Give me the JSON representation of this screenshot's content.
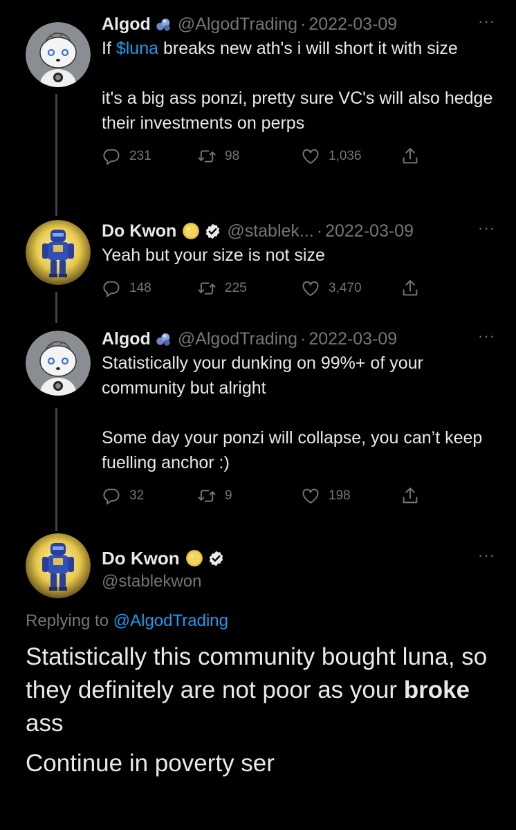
{
  "tweets": [
    {
      "name": "Algod",
      "handle": "@AlgodTrading",
      "date": "2022-03-09",
      "text_before": "If ",
      "cashtag": "$luna",
      "text_after": " breaks new ath's i will short it with size",
      "para2": "it's a big ass ponzi, pretty sure VC's will also hedge their investments on perps",
      "replies": "231",
      "retweets": "98",
      "likes": "1,036"
    },
    {
      "name": "Do Kwon",
      "handle": "@stablek...",
      "date": "2022-03-09",
      "text": "Yeah but your size is not size",
      "replies": "148",
      "retweets": "225",
      "likes": "3,470"
    },
    {
      "name": "Algod",
      "handle": "@AlgodTrading",
      "date": "2022-03-09",
      "para1": "Statistically your dunking on 99%+ of your community but alright",
      "para2": "Some day your ponzi will collapse, you can’t keep fuelling anchor :)",
      "replies": "32",
      "retweets": "9",
      "likes": "198"
    }
  ],
  "main": {
    "name": "Do Kwon",
    "handle": "@stablekwon",
    "replying_label": "Replying to ",
    "replying_to": "@AlgodTrading",
    "line1_before": "Statistically this community bought luna, so they definitely are not poor as your ",
    "bold_word": "broke",
    "line1_after": " ass",
    "line2": "Continue in poverty ser"
  },
  "more_label": "···",
  "dot_sep": "·",
  "icons": [
    "reply-icon",
    "retweet-icon",
    "like-icon",
    "share-icon",
    "verified-badge-icon",
    "gold-coin-icon",
    "blue-gem-icon"
  ],
  "colors": {
    "background": "#000000",
    "link": "#1d9bf0",
    "muted": "#71767b",
    "text": "#e7e9ea",
    "thread": "#3f4448",
    "gold": "#e8c340"
  }
}
